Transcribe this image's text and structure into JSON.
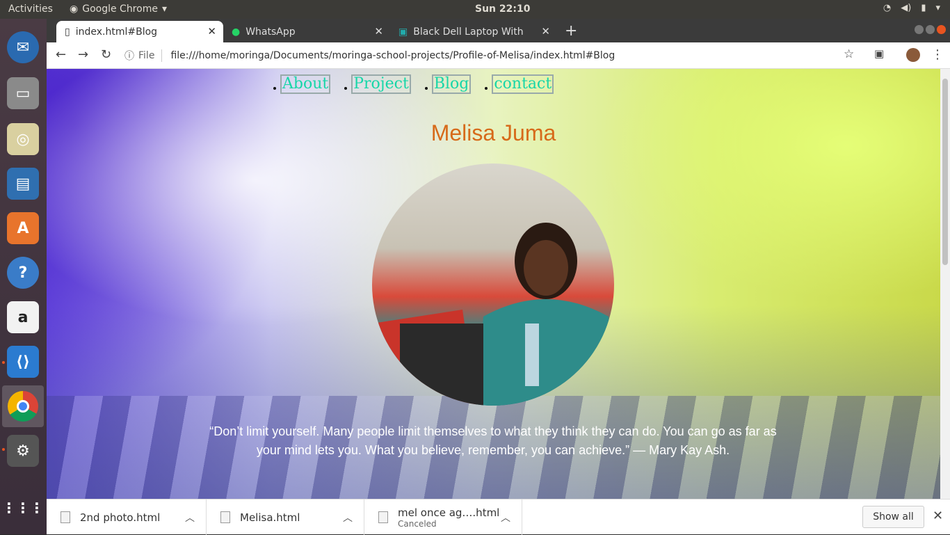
{
  "topbar": {
    "activities": "Activities",
    "app": "Google Chrome",
    "clock": "Sun 22:10"
  },
  "tabs": [
    {
      "label": "index.html#Blog",
      "icon": "file-icon"
    },
    {
      "label": "WhatsApp",
      "icon": "whatsapp-icon"
    },
    {
      "label": "Black Dell Laptop With Bl",
      "icon": "page-icon"
    }
  ],
  "omnibox": {
    "scheme": "File",
    "url": "file:///home/moringa/Documents/moringa-school-projects/Profile-of-Melisa/index.html#Blog"
  },
  "page": {
    "nav": [
      "About",
      "Project",
      "Blog",
      "contact"
    ],
    "name": "Melisa Juma",
    "quote": "“Don’t limit yourself. Many people limit themselves to what they think they can do. You can go as far as your mind lets you. What you believe, remember, you can achieve.” — Mary Kay Ash."
  },
  "downloads": [
    {
      "name": "2nd photo.html",
      "status": ""
    },
    {
      "name": "Melisa.html",
      "status": ""
    },
    {
      "name": "mel once ag….html",
      "status": "Canceled"
    }
  ],
  "show_all": "Show all",
  "colors": {
    "name": "#d76a1a",
    "nav_link": "#17d6a8",
    "accent": "#e95420"
  }
}
